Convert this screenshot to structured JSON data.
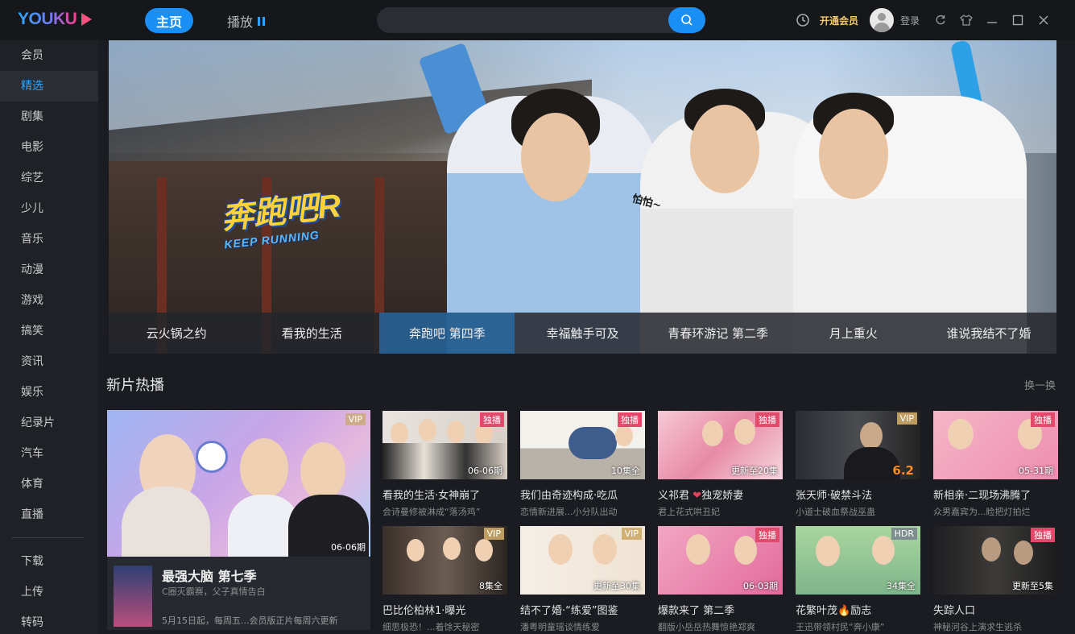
{
  "app": {
    "logo": "YOUKU"
  },
  "topnav": {
    "home": "主页",
    "play": "播放"
  },
  "search": {
    "placeholder": ""
  },
  "header": {
    "vip_open": "开通会员",
    "login": "登录"
  },
  "sidebar": {
    "items": [
      "会员",
      "精选",
      "剧集",
      "电影",
      "综艺",
      "少儿",
      "音乐",
      "动漫",
      "游戏",
      "搞笑",
      "资讯",
      "娱乐",
      "纪录片",
      "汽车",
      "体育",
      "直播"
    ],
    "active": "精选",
    "bottom_items": [
      "下载",
      "上传",
      "转码"
    ]
  },
  "banner": {
    "logo_cn": "奔跑吧R",
    "logo_en": "KEEP RUNNING",
    "speech": "怕怕~",
    "tabs": [
      "云火锅之约",
      "看我的生活",
      "奔跑吧 第四季",
      "幸福触手可及",
      "青春环游记 第二季",
      "月上重火",
      "谁说我结不了婚"
    ],
    "active_tab": "奔跑吧 第四季"
  },
  "section": {
    "title": "新片热播",
    "more": "换一换"
  },
  "feature": {
    "badge": "VIP",
    "episode": "06-06期",
    "title": "最强大脑 第七季",
    "subtitle": "C圈灭霸赛，父子真情告白",
    "desc": "5月15日起，每周五...会员版正片每周六更新"
  },
  "cards": [
    {
      "badge": "独播",
      "badge_type": "ex",
      "count": "06-06期",
      "title": "看我的生活·女神崩了",
      "sub": "会诗曼修被淋成“落汤鸡”"
    },
    {
      "badge": "独播",
      "badge_type": "ex",
      "count": "10集全",
      "title": "我们由奇迹构成·吃瓜",
      "sub": "恋情新进展...小分队出动"
    },
    {
      "badge": "独播",
      "badge_type": "ex",
      "count": "更新至20集",
      "title": "义祁君",
      "title_after": "独宠娇妻",
      "sub": "君上花式哄丑妃"
    },
    {
      "badge": "VIP",
      "badge_type": "vip",
      "score": "6.2",
      "title": "张天师·破禁斗法",
      "sub": "小道士破血祭战巫蛊"
    },
    {
      "badge": "独播",
      "badge_type": "ex",
      "count": "05-31期",
      "title": "新相亲·二现场沸腾了",
      "sub": "众男嘉宾为...睑把灯拍烂"
    },
    {
      "badge": "VIP",
      "badge_type": "vip",
      "count": "8集全",
      "title": "巴比伦柏林1·曝光",
      "sub": "细思极恐！...着馀天秘密"
    },
    {
      "badge": "VIP",
      "badge_type": "vip",
      "count": "更新至30集",
      "title": "结不了婚·“练爱”图鉴",
      "sub": "潘粤明童瑶谈情练爱"
    },
    {
      "badge": "独播",
      "badge_type": "ex",
      "count": "06-03期",
      "title": "爆款来了 第二季",
      "sub": "翻版小岳岳热舞惊艳郑爽"
    },
    {
      "badge": "HDR",
      "badge_type": "hdr",
      "count": "34集全",
      "title": "花繁叶茂",
      "title_after": "励志",
      "sub": "王迅带领村民“奔小康”"
    },
    {
      "badge": "独播",
      "badge_type": "ex",
      "count": "更新至5集",
      "title": "失踪人口",
      "sub": "神秘河谷上演求生逃杀"
    }
  ],
  "colors": {
    "accent": "#1a8ff5",
    "exclusive": "#e04a6b",
    "vip": "#cdaa69",
    "bg": "#1a1c21"
  }
}
